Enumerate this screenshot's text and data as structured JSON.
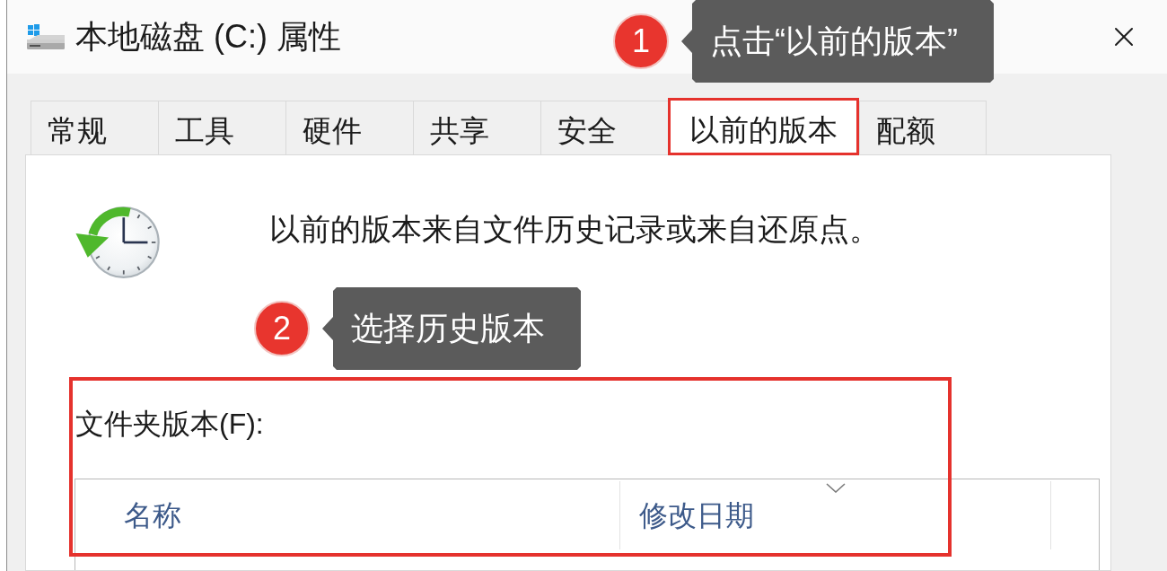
{
  "window": {
    "title": "本地磁盘 (C:) 属性",
    "callout": {
      "number": "1",
      "text": "点击“以前的版本”"
    }
  },
  "tabs": [
    {
      "label": "常规",
      "selected": false,
      "highlighted": false
    },
    {
      "label": "工具",
      "selected": false,
      "highlighted": false
    },
    {
      "label": "硬件",
      "selected": false,
      "highlighted": false
    },
    {
      "label": "共享",
      "selected": false,
      "highlighted": false
    },
    {
      "label": "安全",
      "selected": false,
      "highlighted": false
    },
    {
      "label": "以前的版本",
      "selected": true,
      "highlighted": true
    },
    {
      "label": "配额",
      "selected": false,
      "highlighted": false
    }
  ],
  "panel": {
    "description": "以前的版本来自文件历史记录或来自还原点。",
    "callout": {
      "number": "2",
      "text": "选择历史版本"
    },
    "versions": {
      "label": "文件夹版本(F):",
      "highlighted": true,
      "columns": [
        {
          "label": "名称",
          "sorted": false
        },
        {
          "label": "修改日期",
          "sorted": true
        }
      ]
    }
  }
}
